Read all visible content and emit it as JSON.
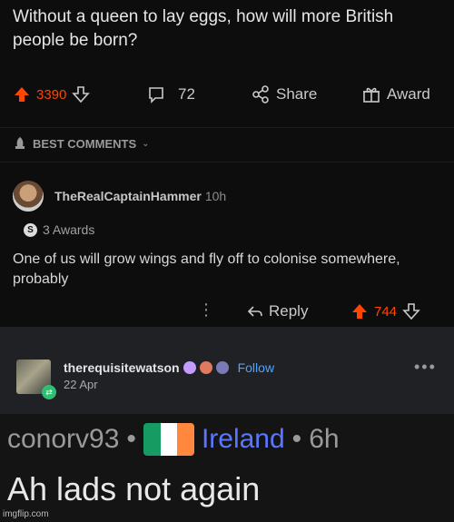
{
  "post": {
    "title": "Without a queen to lay eggs, how will more British people be born?",
    "score": "3390",
    "comments": "72",
    "share": "Share",
    "award": "Award"
  },
  "sort": {
    "label": "BEST COMMENTS"
  },
  "comment": {
    "author": "TheRealCaptainHammer",
    "age": "10h",
    "awards": "3 Awards",
    "award_badge": "S",
    "body": "One of us will grow wings and fly off to colonise somewhere, probably",
    "reply": "Reply",
    "score": "744"
  },
  "tweet": {
    "handle": "therequisitewatson",
    "follow": "Follow",
    "date": "22 Apr",
    "embed": {
      "user": "conorv93",
      "country": "Ireland",
      "age": "6h",
      "text": "Ah lads not again"
    }
  },
  "watermark": "imgflip.com",
  "colors": {
    "upvote": "#ff4500",
    "follow": "#4fa3ff",
    "flag_green": "#169b62",
    "flag_white": "#ffffff",
    "flag_orange": "#ff883e"
  }
}
